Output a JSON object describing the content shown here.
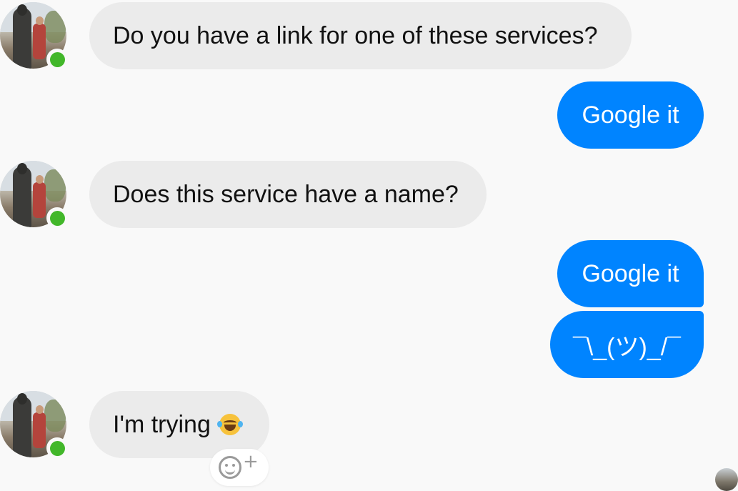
{
  "conversation": {
    "messages": [
      {
        "sender": "contact",
        "text": "Do you have a link for one of these services?"
      },
      {
        "sender": "me",
        "text": "Google it"
      },
      {
        "sender": "contact",
        "text": "Does this service have a name?"
      },
      {
        "sender": "me",
        "text": "Google it"
      },
      {
        "sender": "me",
        "text": "¯\\_(ツ)_/¯"
      },
      {
        "sender": "contact",
        "text": "I'm trying",
        "emoji": "tears-of-joy"
      }
    ]
  },
  "colors": {
    "incoming_bubble": "#ebebeb",
    "outgoing_bubble": "#0084ff",
    "online_indicator": "#42b72a",
    "background": "#f9f9f9"
  },
  "icons": {
    "avatar": "contact-avatar-photo",
    "online": "online-status-dot",
    "reaction": "add-reaction-icon",
    "read_receipt": "read-receipt-avatar"
  }
}
